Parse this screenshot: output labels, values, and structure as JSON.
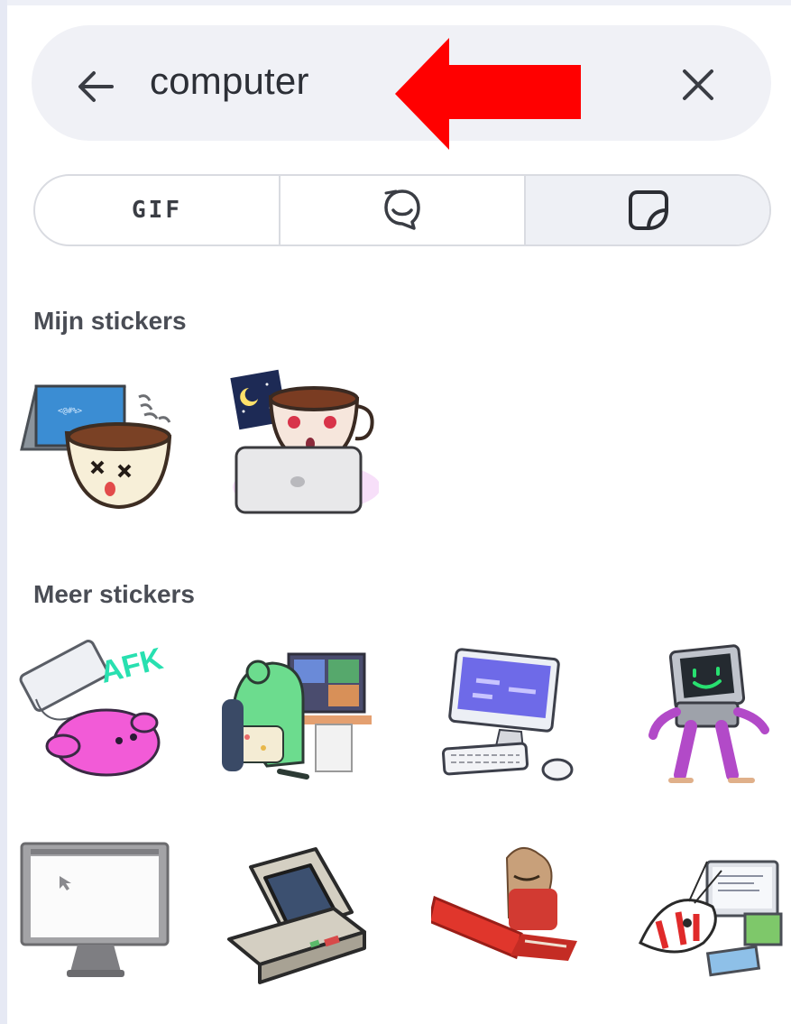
{
  "search": {
    "query": "computer",
    "back_icon": "arrow-left-icon",
    "clear_icon": "close-icon"
  },
  "tabs": [
    {
      "label": "GIF",
      "icon": "gif-text"
    },
    {
      "label": "",
      "icon": "emoji-bubble-icon"
    },
    {
      "label": "",
      "icon": "sticker-icon",
      "selected": true
    }
  ],
  "sections": {
    "mine": {
      "title": "Mijn stickers"
    },
    "more": {
      "title": "Meer stickers"
    }
  },
  "stickers_mine": [
    {
      "name": "coffee-cup-laptop-dizzy-sticker"
    },
    {
      "name": "coffee-cup-night-laptop-sticker"
    }
  ],
  "stickers_more": [
    {
      "name": "afk-pink-creature-keyboard-sticker",
      "text": "AFK"
    },
    {
      "name": "green-monster-desk-computer-sticker"
    },
    {
      "name": "desktop-computer-keyboard-mouse-sticker"
    },
    {
      "name": "walking-computer-robot-sticker"
    },
    {
      "name": "monitor-cursor-sticker"
    },
    {
      "name": "retro-computer-sticker"
    },
    {
      "name": "cat-red-laptop-sticker"
    },
    {
      "name": "shrimp-computer-desk-sticker"
    }
  ],
  "colors": {
    "annotation_arrow": "#ff0000",
    "search_bg": "#f0f1f6",
    "segment_selected": "#eef0f5"
  }
}
